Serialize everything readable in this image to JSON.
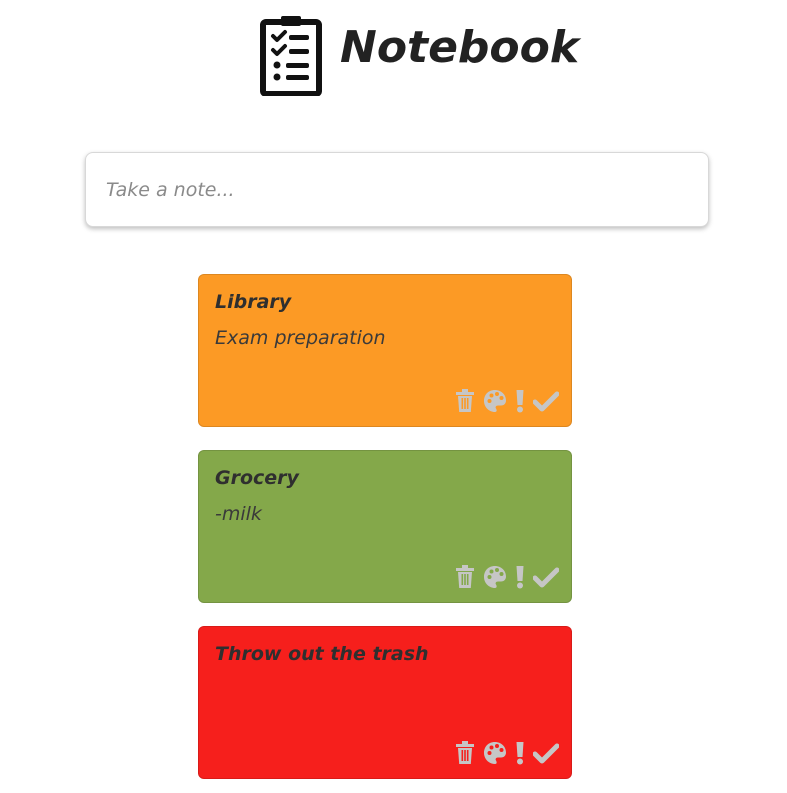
{
  "app": {
    "title": "Notebook"
  },
  "composer": {
    "placeholder": "Take a note..."
  },
  "colors": {
    "icon": "#c6c6c6",
    "note_orange": "#fc9a25",
    "note_green": "#84a84a",
    "note_red": "#f61f1c"
  },
  "notes": [
    {
      "title": "Library",
      "body": "Exam preparation",
      "color": "#fc9a25"
    },
    {
      "title": "Grocery",
      "body": "-milk",
      "color": "#84a84a"
    },
    {
      "title": "Throw out the trash",
      "body": "",
      "color": "#f61f1c"
    }
  ],
  "note_actions": [
    "trash-icon",
    "palette-icon",
    "exclamation-icon",
    "check-icon"
  ]
}
